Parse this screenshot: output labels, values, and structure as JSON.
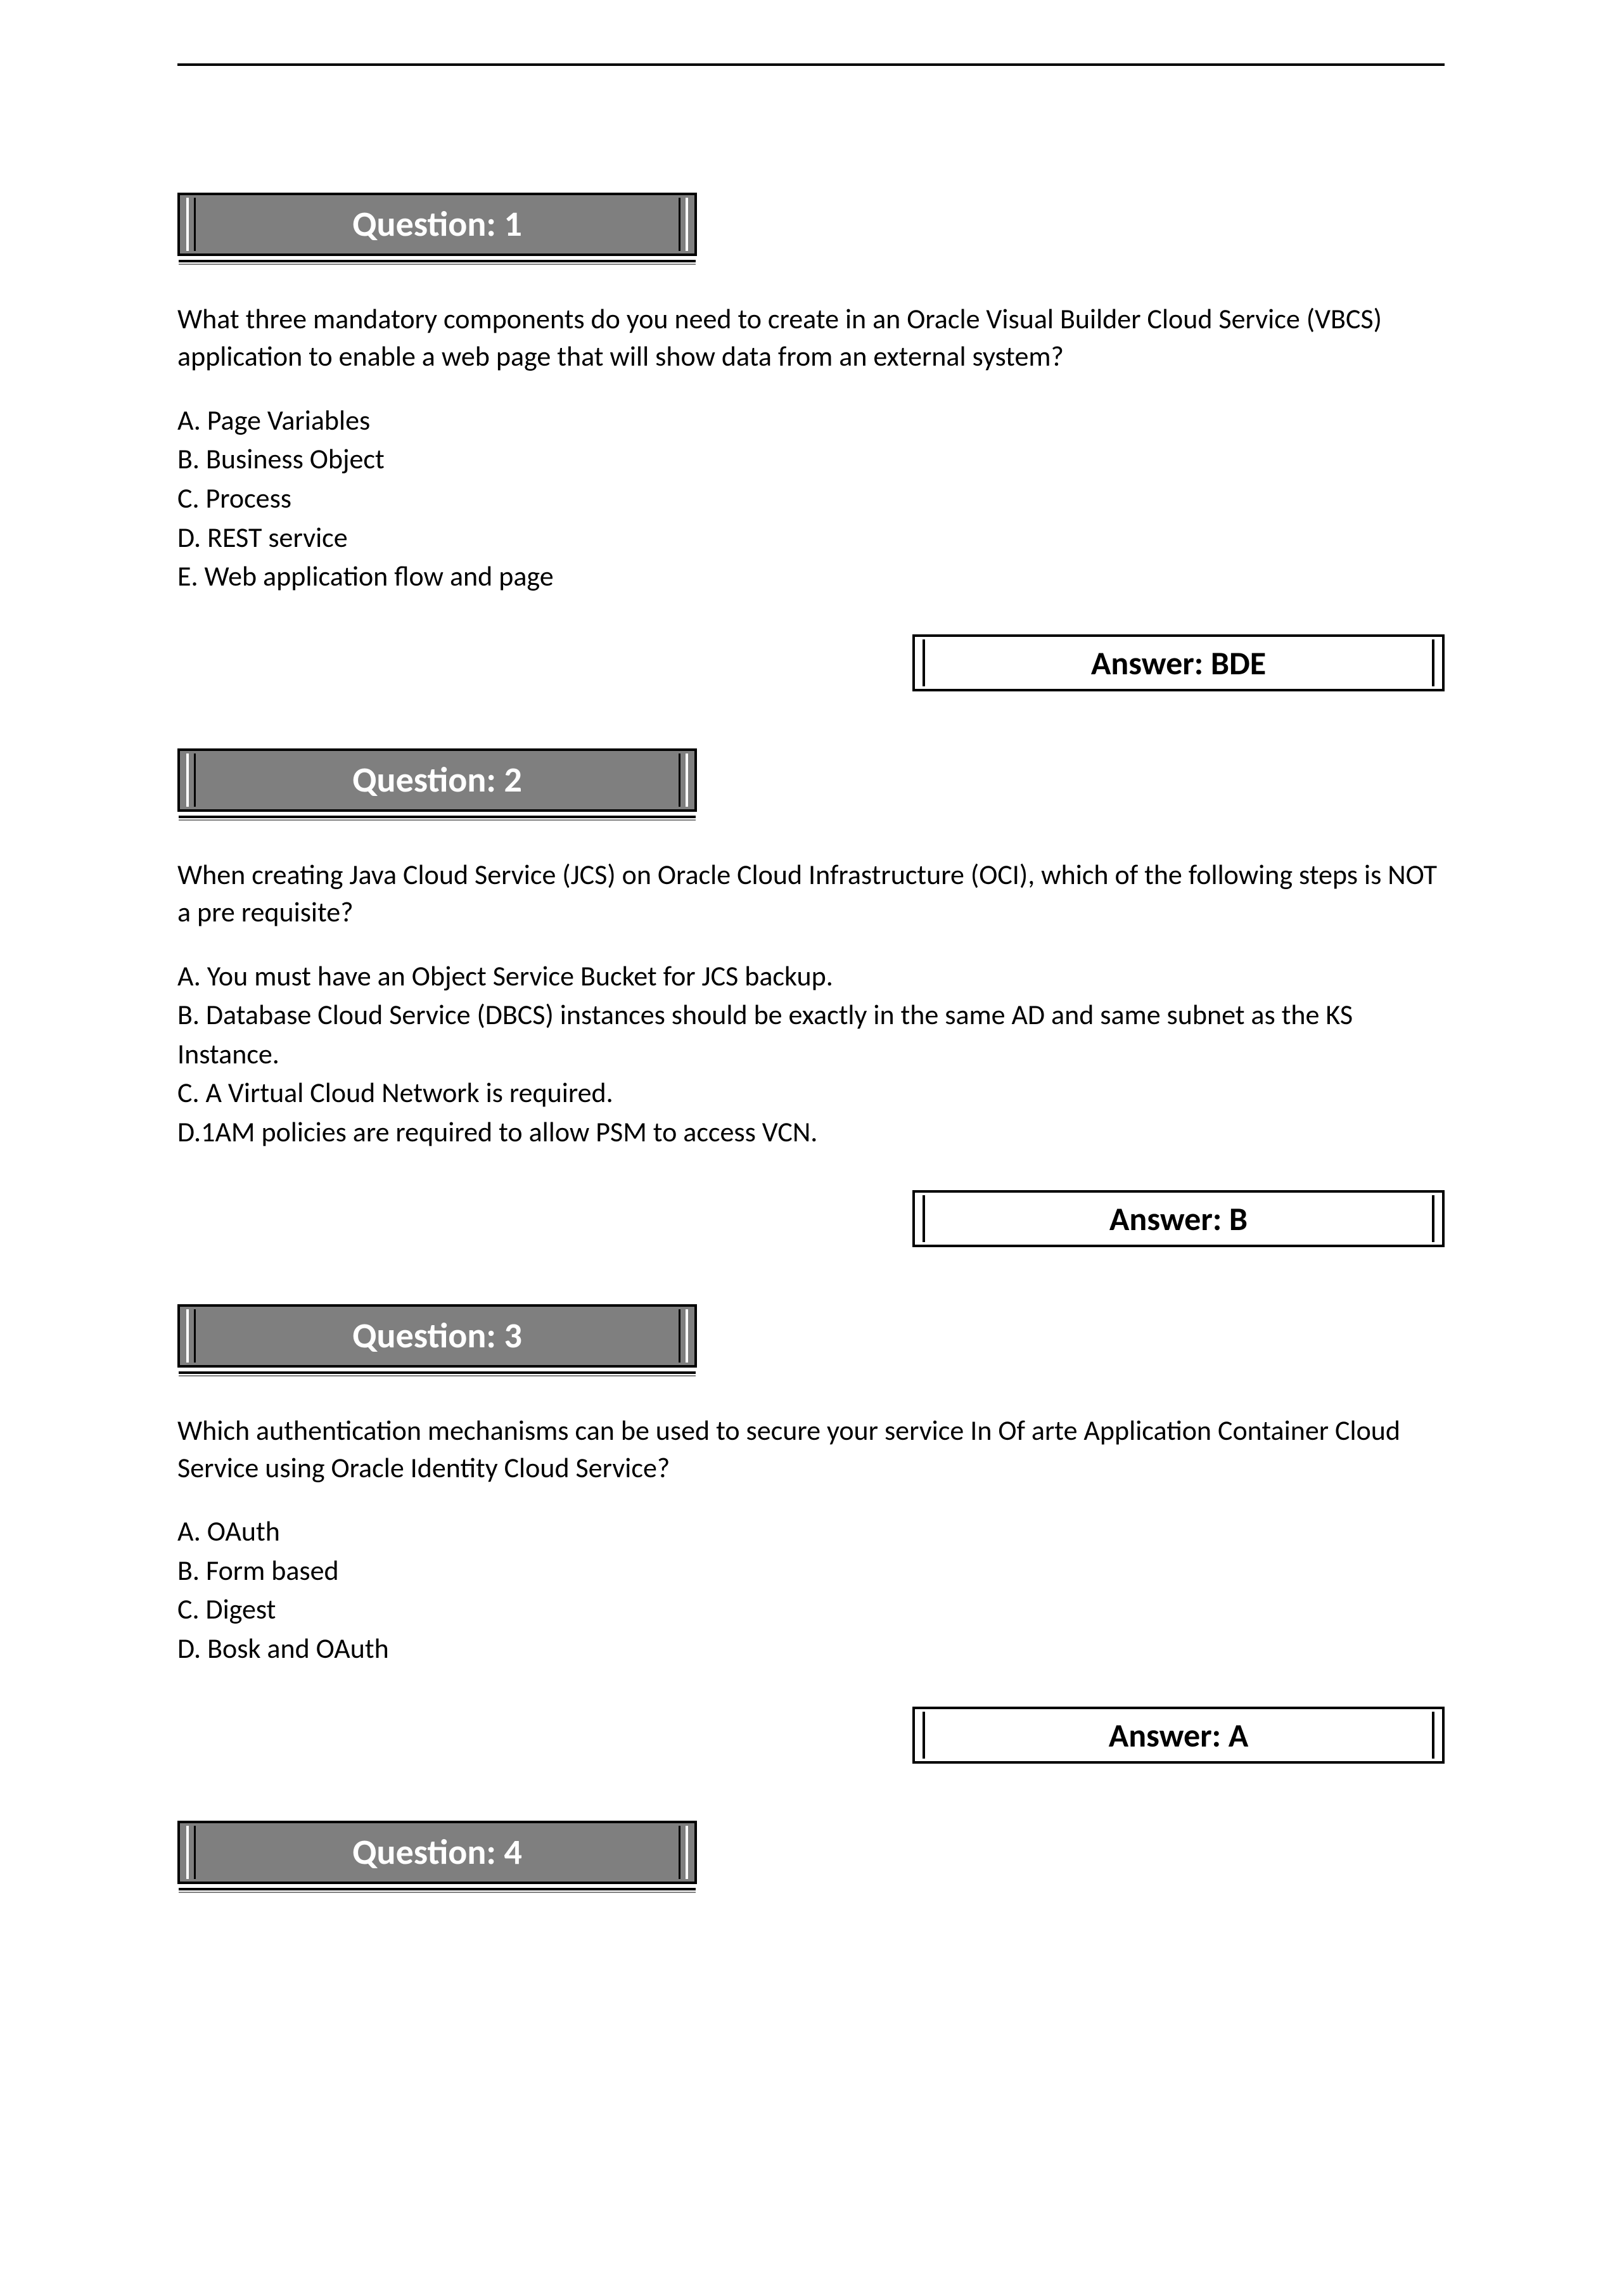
{
  "questions": [
    {
      "title": "Question: 1",
      "text": "What three mandatory components do you need to create in an Oracle Visual Builder Cloud Service (VBCS) application to enable a web page that will show data from an external system?",
      "options": [
        "A. Page Variables",
        "B. Business Object",
        "C. Process",
        "D. REST service",
        "E. Web application flow and page"
      ],
      "answer": "Answer: BDE"
    },
    {
      "title": "Question: 2",
      "text": "When creating Java Cloud Service (JCS) on Oracle Cloud Infrastructure (OCI), which of the following steps is NOT a pre requisite?",
      "options": [
        "A. You must have an Object Service Bucket for JCS backup.",
        "B. Database Cloud Service (DBCS) instances should be exactly in the same AD and same subnet as the KS Instance.",
        "C. A Virtual Cloud Network is required.",
        "D.1AM policies are required to allow PSM to access VCN."
      ],
      "answer": "Answer: B"
    },
    {
      "title": "Question: 3",
      "text": "Which authentication mechanisms can be used to secure your service In Of arte Application Container Cloud Service using Oracle Identity Cloud Service?",
      "options": [
        "A. OAuth",
        "B. Form based",
        "C. Digest",
        "D. Bosk and OAuth"
      ],
      "answer": "Answer: A"
    },
    {
      "title": "Question: 4",
      "text": "",
      "options": [],
      "answer": ""
    }
  ]
}
